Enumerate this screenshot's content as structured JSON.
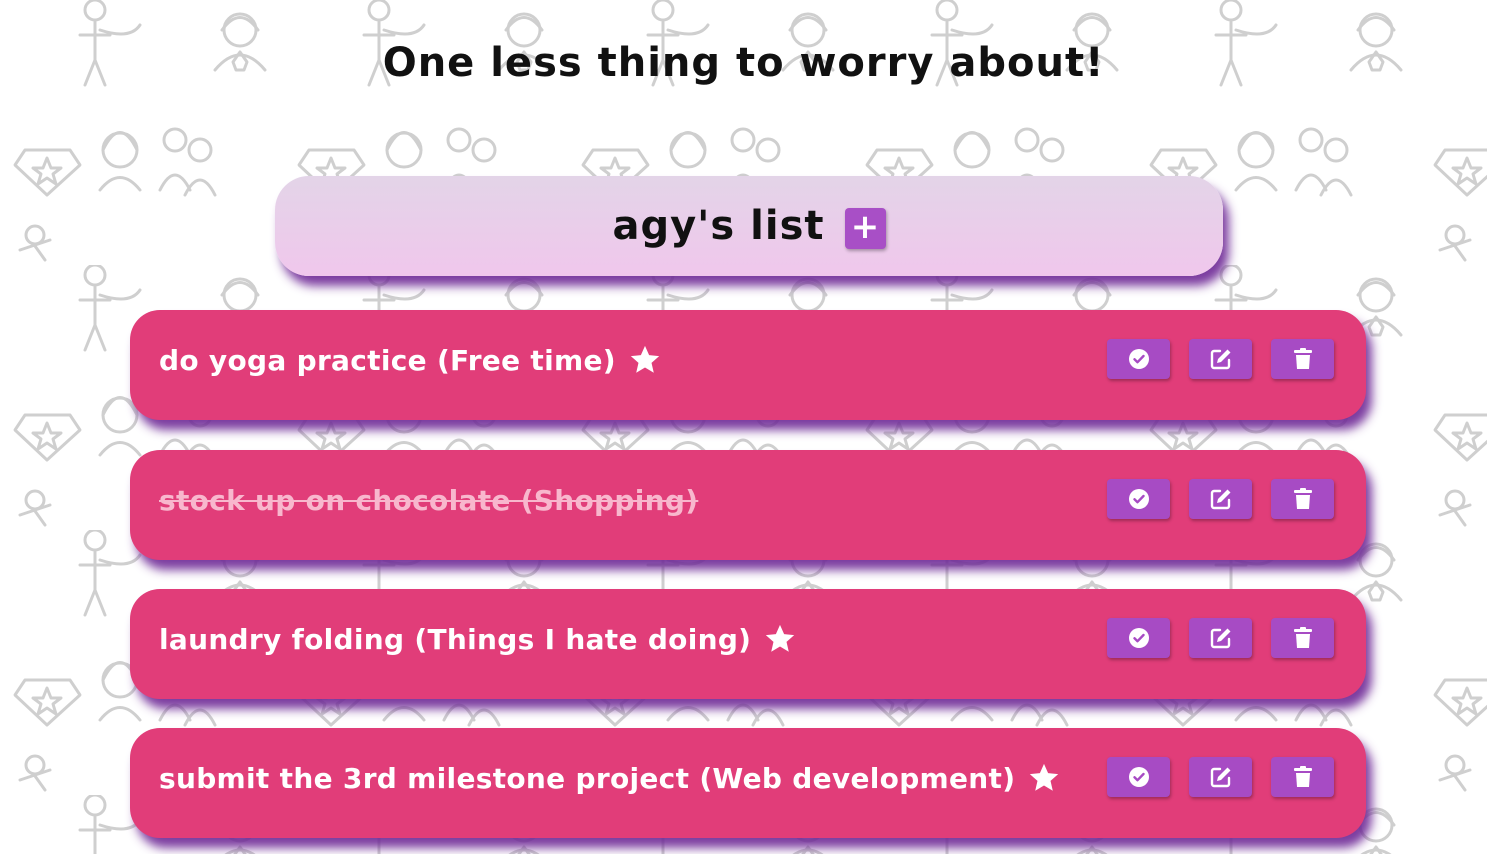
{
  "tagline": "One less thing to worry about!",
  "list": {
    "title": "agy's list",
    "add_label": "+"
  },
  "tasks": [
    {
      "text": "do yoga practice (Free time)",
      "starred": true,
      "done": false
    },
    {
      "text": "stock up on chocolate (Shopping)",
      "starred": false,
      "done": true
    },
    {
      "text": "laundry folding (Things I hate doing)",
      "starred": true,
      "done": false
    },
    {
      "text": "submit the 3rd milestone project (Web development)",
      "starred": true,
      "done": false
    }
  ],
  "colors": {
    "task_background": "#e13d79",
    "button_purple": "#a74bc4",
    "header_gradient_top": "#e3d4e8",
    "header_gradient_bottom": "#f0c7ec",
    "shadow_purple": "#6e2896"
  },
  "icons": {
    "complete": "check-circle-icon",
    "edit": "edit-icon",
    "delete": "trash-icon",
    "important": "star-icon",
    "background": "superhero-pattern"
  }
}
